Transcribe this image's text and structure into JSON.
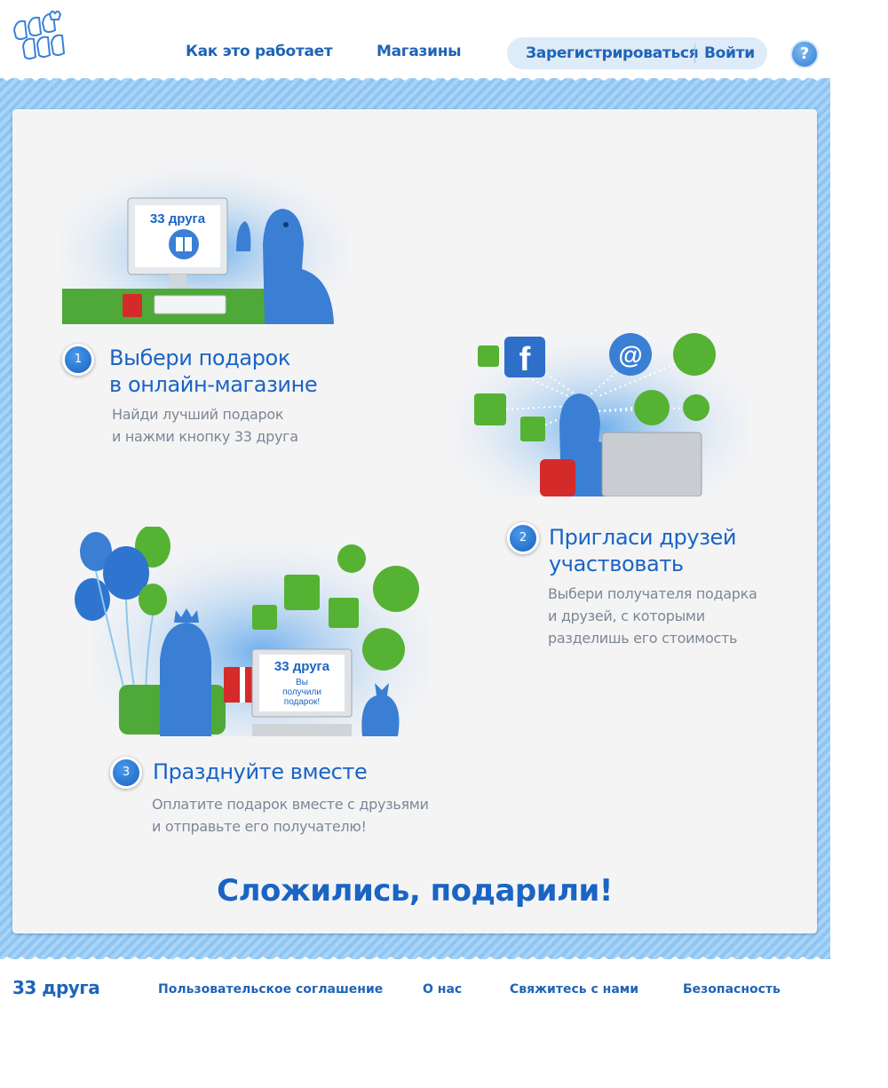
{
  "header": {
    "nav": [
      "Как это работает",
      "Магазины"
    ],
    "register": "Зарегистрироваться",
    "login": "Войти",
    "help": "?"
  },
  "steps": [
    {
      "num": "1",
      "title_line1": "Выбери подарок",
      "title_line2": "в онлайн-магазине",
      "desc_line1": "Найди лучший подарок",
      "desc_line2": "и нажми кнопку 33 друга"
    },
    {
      "num": "2",
      "title_line1": "Пригласи друзей",
      "title_line2": "участвовать",
      "desc_line1": "Выбери получателя подарка",
      "desc_line2": "и друзей, с которыми",
      "desc_line3": "разделишь его стоимость"
    },
    {
      "num": "3",
      "title_line1": "Празднуйте вместе",
      "desc_line1": "Оплатите подарок вместе с друзьями",
      "desc_line2": "и отправьте его получателю!"
    }
  ],
  "illustrations": {
    "screen_brand": "33 друга",
    "laptop_brand": "33 друга",
    "laptop_msg_line1": "Вы",
    "laptop_msg_line2": "получили",
    "laptop_msg_line3": "подарок!",
    "facebook_letter": "f",
    "at_sign": "@"
  },
  "slogan": "Сложились, подарили!",
  "footer": {
    "logo": "33 друга",
    "links": [
      "Пользовательское соглашение",
      "О нас",
      "Свяжитесь с нами",
      "Безопасность"
    ]
  },
  "colors": {
    "brand_blue": "#1a64c4",
    "green": "#55b233",
    "band": "#a9d4f7"
  }
}
